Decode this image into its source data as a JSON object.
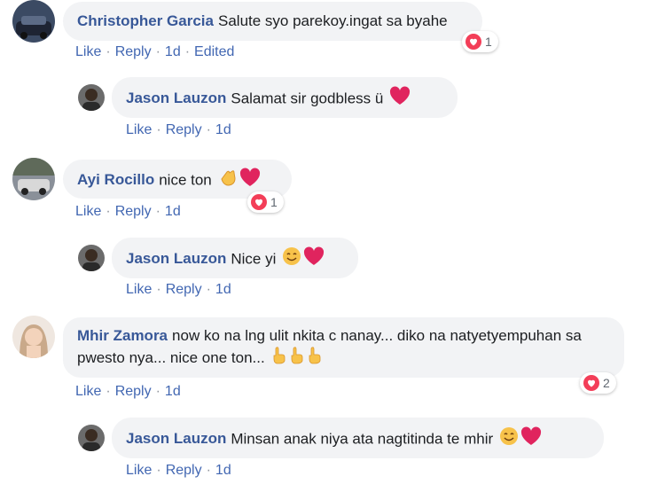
{
  "comments": [
    {
      "author": "Christopher Garcia",
      "text": "Salute syo parekoy.ingat sa byahe",
      "like": "Like",
      "reply": "Reply",
      "time": "1d",
      "edited": "Edited",
      "reaction_count": "1"
    },
    {
      "author": "Jason Lauzon",
      "text": "Salamat sir godbless ü",
      "like": "Like",
      "reply": "Reply",
      "time": "1d"
    },
    {
      "author": "Ayi Rocillo",
      "text": "nice ton",
      "like": "Like",
      "reply": "Reply",
      "time": "1d",
      "reaction_count": "1"
    },
    {
      "author": "Jason Lauzon",
      "text": "Nice yi",
      "like": "Like",
      "reply": "Reply",
      "time": "1d"
    },
    {
      "author": "Mhir Zamora",
      "text": "now ko na lng ulit nkita c nanay... diko na natyetyempuhan sa pwesto nya... nice one ton...",
      "like": "Like",
      "reply": "Reply",
      "time": "1d",
      "reaction_count": "2"
    },
    {
      "author": "Jason Lauzon",
      "text": "Minsan anak niya ata nagtitinda te mhir",
      "like": "Like",
      "reply": "Reply",
      "time": "1d"
    }
  ],
  "colors": {
    "link": "#4267b2",
    "name": "#385898",
    "bubble": "#f2f3f5",
    "heart": "#f33e58"
  }
}
